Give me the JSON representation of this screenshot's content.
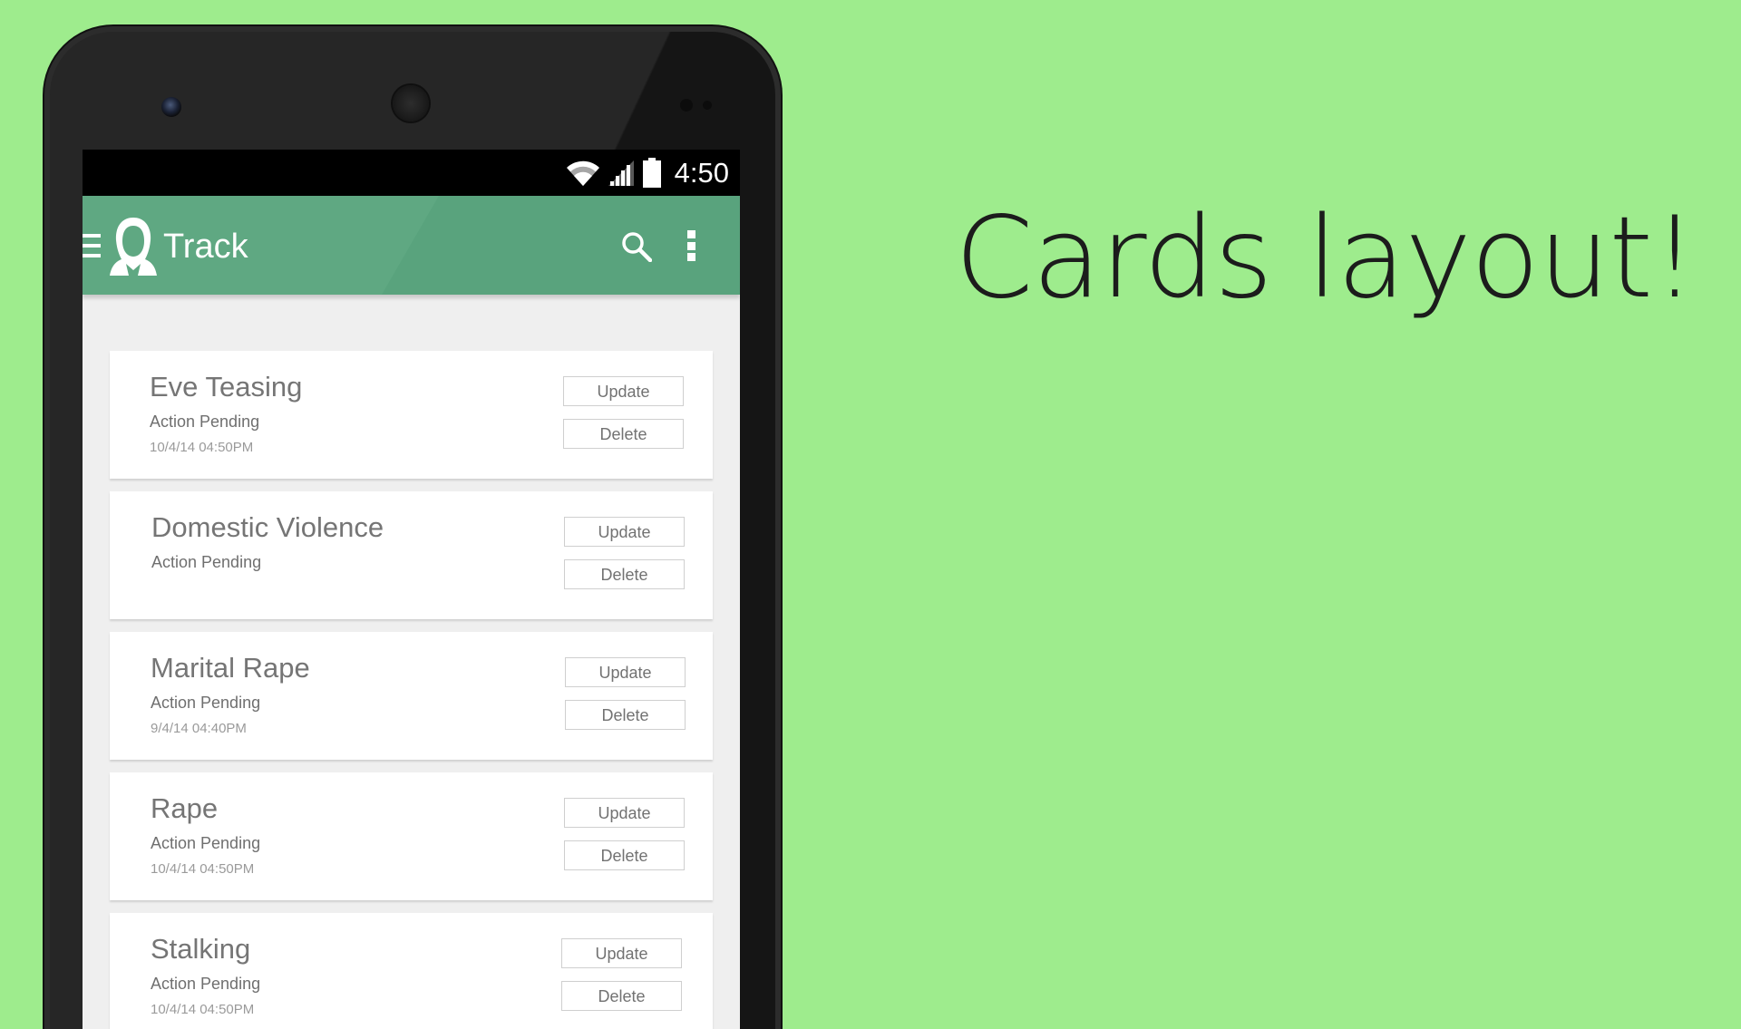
{
  "headline": "Cards layout!",
  "status_bar": {
    "time": "4:50"
  },
  "app_bar": {
    "title": "Track"
  },
  "cards": [
    {
      "title": "Eve Teasing",
      "status": "Action Pending",
      "date": "10/4/14 04:50PM",
      "update_label": "Update",
      "delete_label": "Delete"
    },
    {
      "title": "Domestic Violence",
      "status": "Action Pending",
      "date": "",
      "update_label": "Update",
      "delete_label": "Delete"
    },
    {
      "title": "Marital Rape",
      "status": "Action Pending",
      "date": "9/4/14 04:40PM",
      "update_label": "Update",
      "delete_label": "Delete"
    },
    {
      "title": "Rape",
      "status": "Action Pending",
      "date": "10/4/14 04:50PM",
      "update_label": "Update",
      "delete_label": "Delete"
    },
    {
      "title": "Stalking",
      "status": "Action Pending",
      "date": "10/4/14 04:50PM",
      "update_label": "Update",
      "delete_label": "Delete"
    }
  ],
  "colors": {
    "background": "#9eec8d",
    "app_bar": "#5fa882",
    "headline_text": "#1c1c1c"
  },
  "icons": [
    "wifi-icon",
    "cellular-signal-icon",
    "battery-icon",
    "menu-icon",
    "app-logo-icon",
    "search-icon",
    "overflow-menu-icon"
  ]
}
